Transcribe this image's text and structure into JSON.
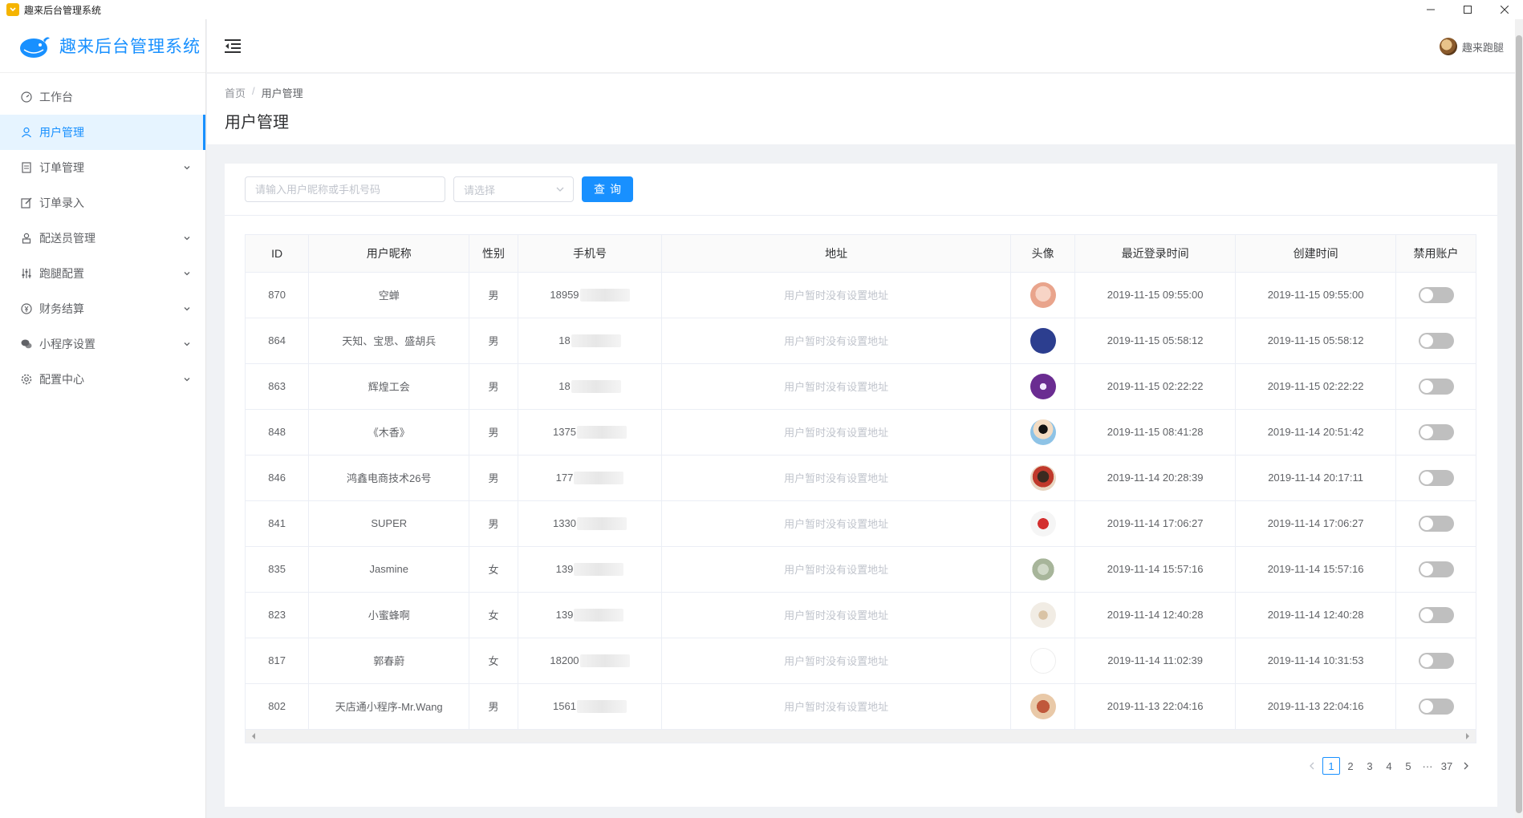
{
  "window": {
    "title": "趣来后台管理系统"
  },
  "sidebar": {
    "logo_text": "趣来后台管理系统",
    "items": [
      {
        "label": "工作台",
        "icon": "dashboard-icon",
        "expandable": false,
        "active": false
      },
      {
        "label": "用户管理",
        "icon": "user-icon",
        "expandable": false,
        "active": true
      },
      {
        "label": "订单管理",
        "icon": "order-icon",
        "expandable": true,
        "active": false
      },
      {
        "label": "订单录入",
        "icon": "edit-icon",
        "expandable": false,
        "active": false
      },
      {
        "label": "配送员管理",
        "icon": "courier-icon",
        "expandable": true,
        "active": false
      },
      {
        "label": "跑腿配置",
        "icon": "sliders-icon",
        "expandable": true,
        "active": false
      },
      {
        "label": "财务结算",
        "icon": "finance-icon",
        "expandable": true,
        "active": false
      },
      {
        "label": "小程序设置",
        "icon": "wechat-icon",
        "expandable": true,
        "active": false
      },
      {
        "label": "配置中心",
        "icon": "gear-icon",
        "expandable": true,
        "active": false
      }
    ]
  },
  "header": {
    "user_name": "趣来跑腿"
  },
  "breadcrumb": {
    "home": "首页",
    "separator": "/",
    "current": "用户管理"
  },
  "page_title": "用户管理",
  "filter": {
    "search_placeholder": "请输入用户昵称或手机号码",
    "select_placeholder": "请选择",
    "query_label": "查询"
  },
  "table": {
    "columns": [
      "ID",
      "用户昵称",
      "性别",
      "手机号",
      "地址",
      "头像",
      "最近登录时间",
      "创建时间",
      "禁用账户"
    ],
    "rows": [
      {
        "id": "870",
        "nickname": "空蝉",
        "gender": "男",
        "phone": "18959",
        "address": "用户暂时没有设置地址",
        "last_login": "2019-11-15 09:55:00",
        "created": "2019-11-15 09:55:00",
        "disabled": false
      },
      {
        "id": "864",
        "nickname": "天知、宝思、盛胡兵",
        "gender": "男",
        "phone": "18",
        "address": "用户暂时没有设置地址",
        "last_login": "2019-11-15 05:58:12",
        "created": "2019-11-15 05:58:12",
        "disabled": false
      },
      {
        "id": "863",
        "nickname": "辉煌工会",
        "gender": "男",
        "phone": "18",
        "address": "用户暂时没有设置地址",
        "last_login": "2019-11-15 02:22:22",
        "created": "2019-11-15 02:22:22",
        "disabled": false
      },
      {
        "id": "848",
        "nickname": "《木香》",
        "gender": "男",
        "phone": "1375",
        "address": "用户暂时没有设置地址",
        "last_login": "2019-11-15 08:41:28",
        "created": "2019-11-14 20:51:42",
        "disabled": false
      },
      {
        "id": "846",
        "nickname": "鸿鑫电商技术26号",
        "gender": "男",
        "phone": "177",
        "address": "用户暂时没有设置地址",
        "last_login": "2019-11-14 20:28:39",
        "created": "2019-11-14 20:17:11",
        "disabled": false
      },
      {
        "id": "841",
        "nickname": "SUPER",
        "gender": "男",
        "phone": "1330",
        "address": "用户暂时没有设置地址",
        "last_login": "2019-11-14 17:06:27",
        "created": "2019-11-14 17:06:27",
        "disabled": false
      },
      {
        "id": "835",
        "nickname": "Jasmine",
        "gender": "女",
        "phone": "139",
        "address": "用户暂时没有设置地址",
        "last_login": "2019-11-14 15:57:16",
        "created": "2019-11-14 15:57:16",
        "disabled": false
      },
      {
        "id": "823",
        "nickname": "小蜜蜂啊",
        "gender": "女",
        "phone": "139",
        "address": "用户暂时没有设置地址",
        "last_login": "2019-11-14 12:40:28",
        "created": "2019-11-14 12:40:28",
        "disabled": false
      },
      {
        "id": "817",
        "nickname": "郭春蔚",
        "gender": "女",
        "phone": "18200",
        "address": "用户暂时没有设置地址",
        "last_login": "2019-11-14 11:02:39",
        "created": "2019-11-14 10:31:53",
        "disabled": false
      },
      {
        "id": "802",
        "nickname": "天店通小程序-Mr.Wang",
        "gender": "男",
        "phone": "1561",
        "address": "用户暂时没有设置地址",
        "last_login": "2019-11-13 22:04:16",
        "created": "2019-11-13 22:04:16",
        "disabled": false
      }
    ]
  },
  "pagination": {
    "pages": [
      "1",
      "2",
      "3",
      "4",
      "5"
    ],
    "ellipsis": "···",
    "last": "37",
    "current": "1"
  },
  "colors": {
    "primary": "#1890ff",
    "switch_off": "#bfbfbf",
    "app_icon": "#f5b400"
  }
}
